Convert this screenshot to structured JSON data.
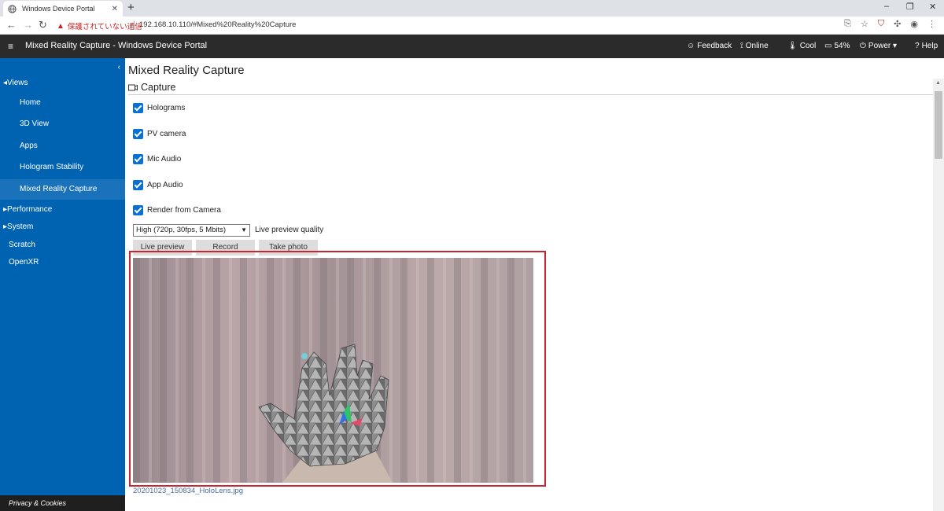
{
  "browser": {
    "tab_title": "Windows Device Portal",
    "tab_close": "✕",
    "new_tab": "+",
    "security_label": "保護されていない通信",
    "url": "192.168.10.110/#Mixed%20Reality%20Capture",
    "window_controls": [
      "–",
      "❐",
      "✕"
    ]
  },
  "header": {
    "menu_icon": "≡",
    "title": "Mixed Reality Capture - Windows Device Portal",
    "items": [
      {
        "icon": "smile-icon",
        "glyph": "☺",
        "label": "Feedback"
      },
      {
        "icon": "signal-icon",
        "glyph": "⟟",
        "label": "Online"
      },
      {
        "icon": "thermometer-icon",
        "glyph": "🌡",
        "label": "Cool"
      },
      {
        "icon": "battery-icon",
        "glyph": "▭",
        "label": "54%"
      },
      {
        "icon": "power-icon",
        "glyph": "⏻",
        "label": "Power ▾"
      },
      {
        "icon": "help-icon",
        "glyph": "?",
        "label": "Help"
      }
    ]
  },
  "sidebar": {
    "collapse": "‹",
    "views_label": "◂Views",
    "view_items": [
      "Home",
      "3D View",
      "Apps",
      "Hologram Stability",
      "Mixed Reality Capture"
    ],
    "performance_label": "▸Performance",
    "system_label": "▸System",
    "scratch_label": "Scratch",
    "openxr_label": "OpenXR",
    "footer": "Privacy & Cookies"
  },
  "main": {
    "title": "Mixed Reality Capture",
    "section": "Capture",
    "checkboxes": [
      {
        "label": "Holograms",
        "checked": true
      },
      {
        "label": "PV camera",
        "checked": true
      },
      {
        "label": "Mic Audio",
        "checked": true
      },
      {
        "label": "App Audio",
        "checked": true
      },
      {
        "label": "Render from Camera",
        "checked": true
      }
    ],
    "quality_value": "High (720p, 30fps, 5 Mbits)",
    "quality_label": "Live preview quality",
    "buttons": {
      "live_preview": "Live preview",
      "record": "Record",
      "take_photo": "Take photo"
    },
    "filename": "20201023_150834_HoloLens.jpg"
  },
  "colors": {
    "sidebar": "#0063b1",
    "header": "#2b2b2b",
    "accent": "#0a6fd6",
    "frame": "#c8252e"
  }
}
